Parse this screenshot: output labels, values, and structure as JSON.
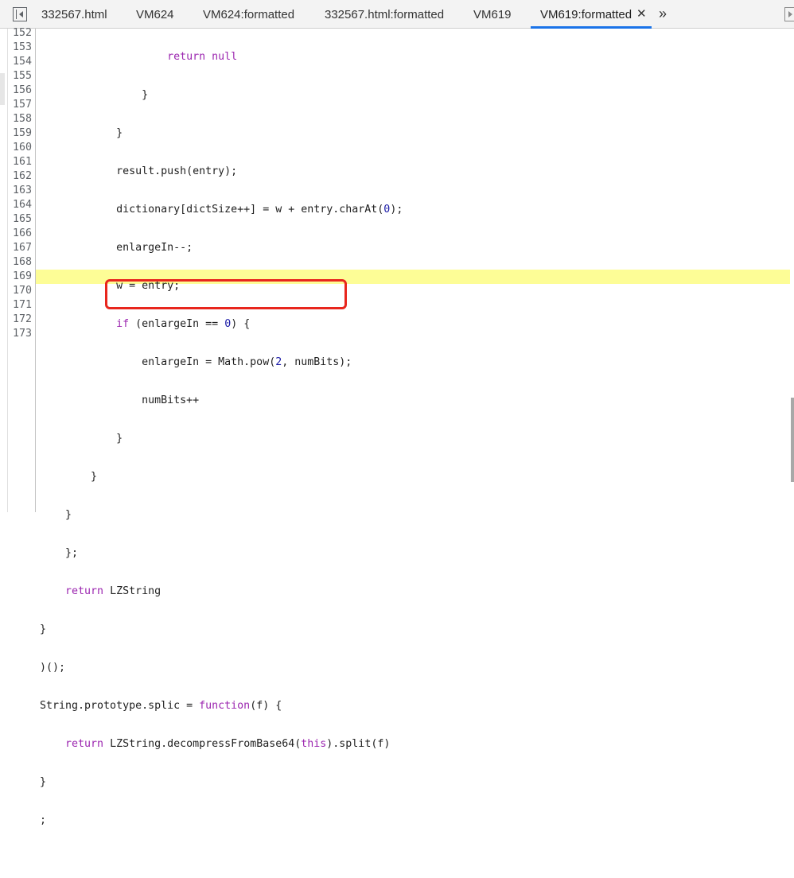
{
  "tabs": [
    {
      "label": "332567.html"
    },
    {
      "label": "VM624"
    },
    {
      "label": "VM624:formatted"
    },
    {
      "label": "332567.html:formatted"
    },
    {
      "label": "VM619"
    },
    {
      "label": "VM619:formatted",
      "active": true
    }
  ],
  "tab_close_glyph": "✕",
  "more_tabs_glyph": "»",
  "line_numbers": [
    "152",
    "153",
    "154",
    "155",
    "156",
    "157",
    "158",
    "159",
    "160",
    "161",
    "162",
    "163",
    "164",
    "165",
    "166",
    "167",
    "168",
    "169",
    "170",
    "171",
    "172",
    "173"
  ],
  "code_lines": [
    "                    return null",
    "                }",
    "            }",
    "            result.push(entry);",
    "            dictionary[dictSize++] = w + entry.charAt(0);",
    "            enlargeIn--;",
    "            w = entry;",
    "            if (enlargeIn == 0) {",
    "                enlargeIn = Math.pow(2, numBits);",
    "                numBits++",
    "            }",
    "        }",
    "    }",
    "    };",
    "    return LZString",
    "}",
    ")();",
    "String.prototype.splic = function(f) {",
    "    return LZString.decompressFromBase64(this).split(f)",
    "}",
    ";",
    ""
  ],
  "highlighted_line": "169",
  "colors": {
    "keyword": "#9c27b0",
    "number": "#1a1aa6",
    "highlight": "#fdfd96",
    "annotation": "#e8261d",
    "active_tab_underline": "#1a73e8"
  },
  "icons": [
    "toggle-navigator-icon",
    "close-icon",
    "more-tabs-icon",
    "toggle-debugger-icon"
  ]
}
